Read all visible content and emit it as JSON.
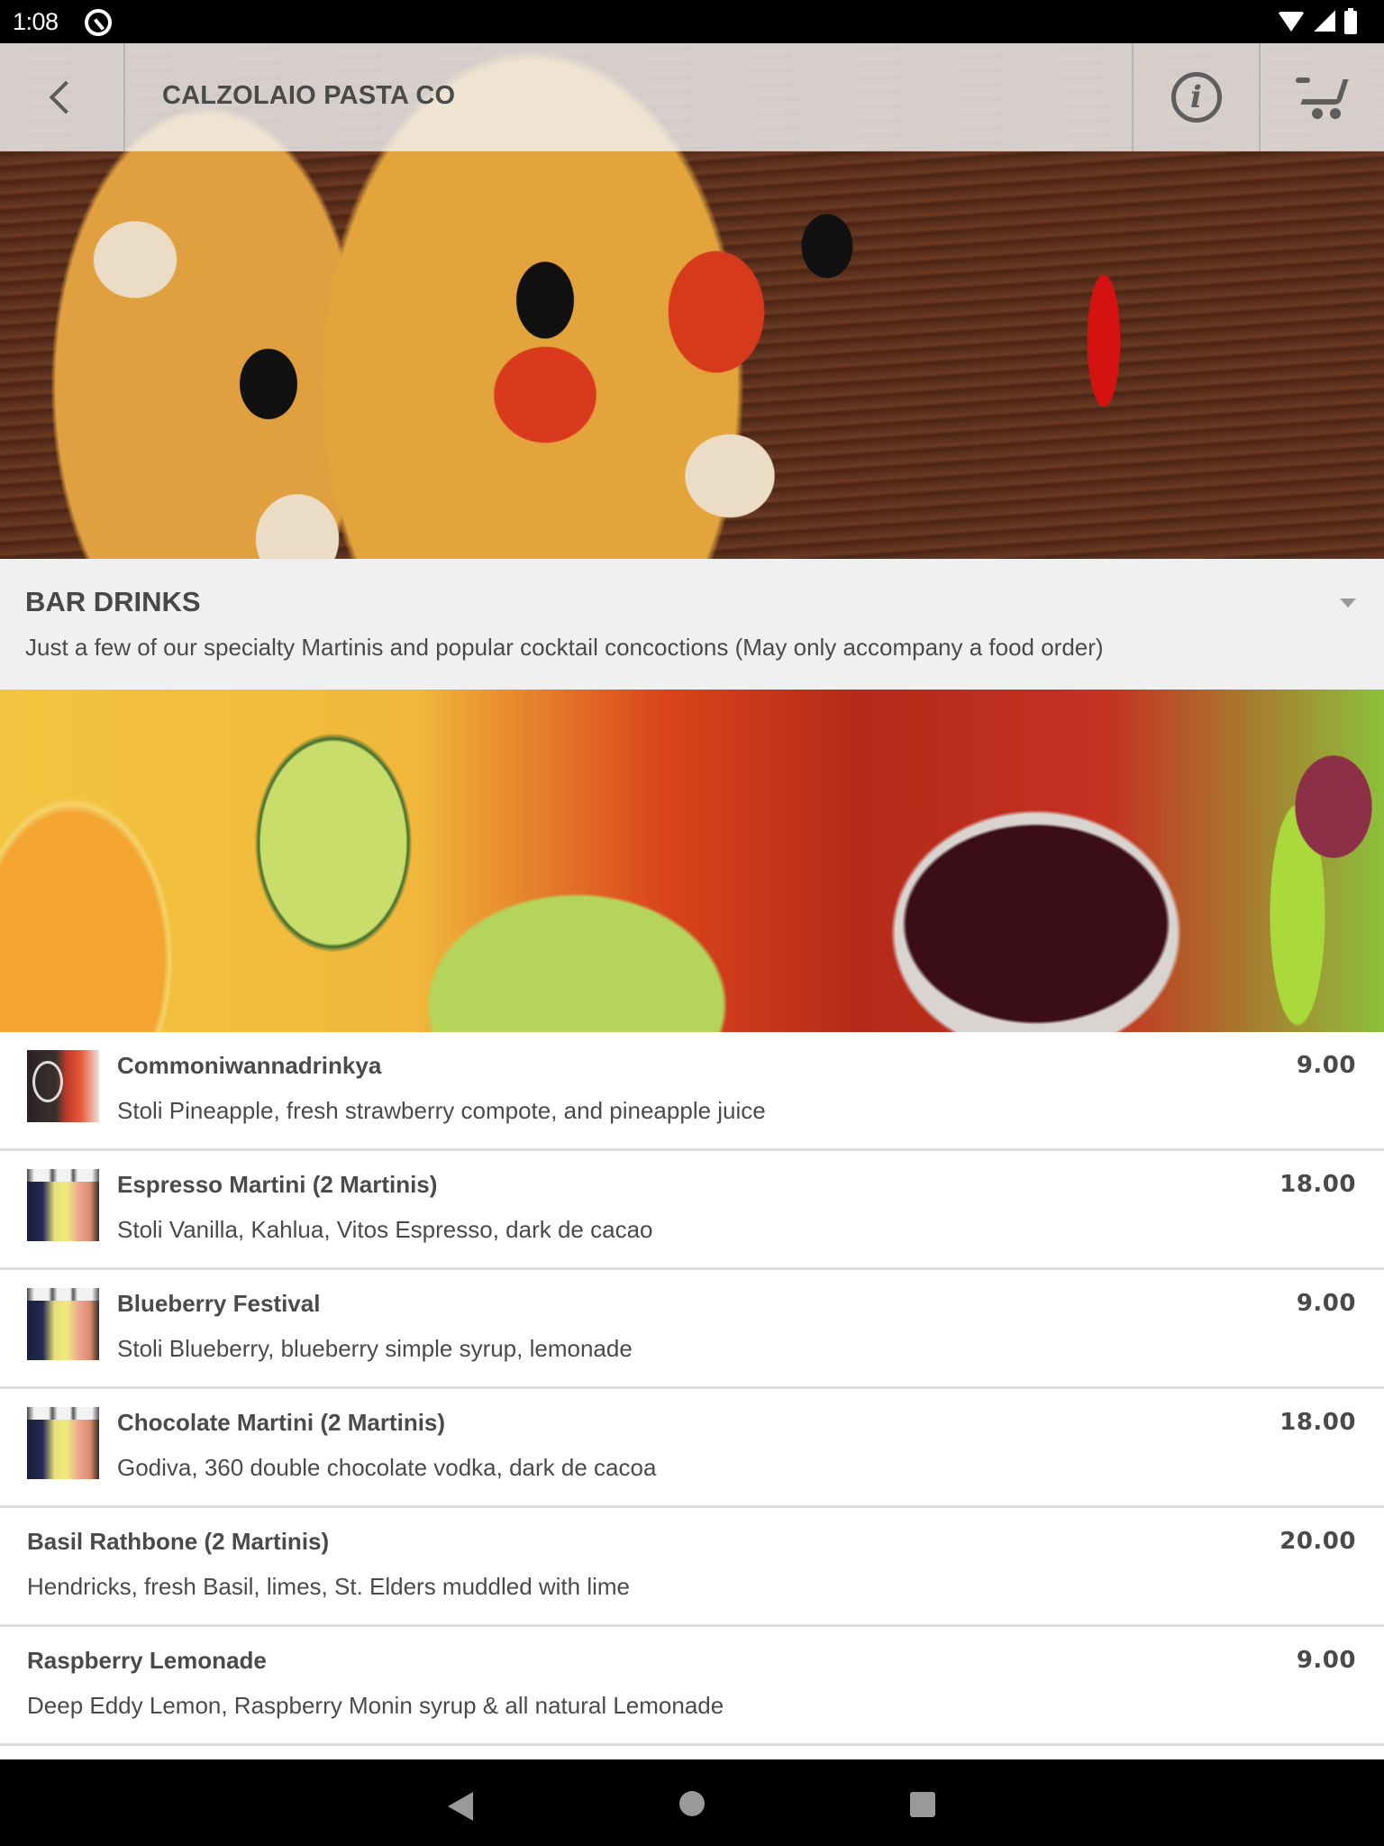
{
  "status_bar": {
    "time": "1:08",
    "icons": [
      "app-notification-icon",
      "wifi-icon",
      "signal-icon",
      "battery-icon"
    ]
  },
  "header": {
    "back_icon": "chevron-left-icon",
    "title": "CALZOLAIO PASTA CO",
    "info_icon": "info-icon",
    "cart_icon": "cart-icon"
  },
  "hero_image": {
    "description": "pizza with olives, tomatoes, mushrooms and chili pepper on wooden table"
  },
  "category": {
    "title": "BAR DRINKS",
    "description": "Just a few of our specialty Martinis and popular cocktail concoctions (May only accompany a food order)",
    "toggle_icon": "caret-down-icon"
  },
  "category_banner": {
    "description": "colorful juice and cocktail glasses with cucumber, orange and celery"
  },
  "menu_items": [
    {
      "name": "Commoniwannadrinkya",
      "description": "Stoli Pineapple, fresh strawberry compote, and pineapple juice",
      "price": "9.00",
      "has_thumbnail": true
    },
    {
      "name": "Espresso Martini (2 Martinis)",
      "description": "Stoli Vanilla, Kahlua, Vitos Espresso, dark de cacao",
      "price": "18.00",
      "has_thumbnail": true
    },
    {
      "name": "Blueberry Festival",
      "description": "Stoli Blueberry, blueberry simple syrup, lemonade",
      "price": "9.00",
      "has_thumbnail": true
    },
    {
      "name": "Chocolate Martini (2 Martinis)",
      "description": "Godiva, 360 double chocolate vodka, dark de cacoa",
      "price": "18.00",
      "has_thumbnail": true
    },
    {
      "name": "Basil Rathbone (2 Martinis)",
      "description": "Hendricks, fresh Basil, limes, St. Elders muddled with lime",
      "price": "20.00",
      "has_thumbnail": false
    },
    {
      "name": "Raspberry Lemonade",
      "description": "Deep Eddy Lemon, Raspberry Monin syrup & all natural Lemonade",
      "price": "9.00",
      "has_thumbnail": false
    }
  ],
  "nav_bar": {
    "buttons": [
      "back-icon",
      "home-icon",
      "recents-icon"
    ]
  },
  "colors": {
    "text_primary": "#4a4a4a",
    "header_bg": "#f2f2f2",
    "category_bg": "#f0f0f0",
    "divider": "#dcdcdc"
  }
}
